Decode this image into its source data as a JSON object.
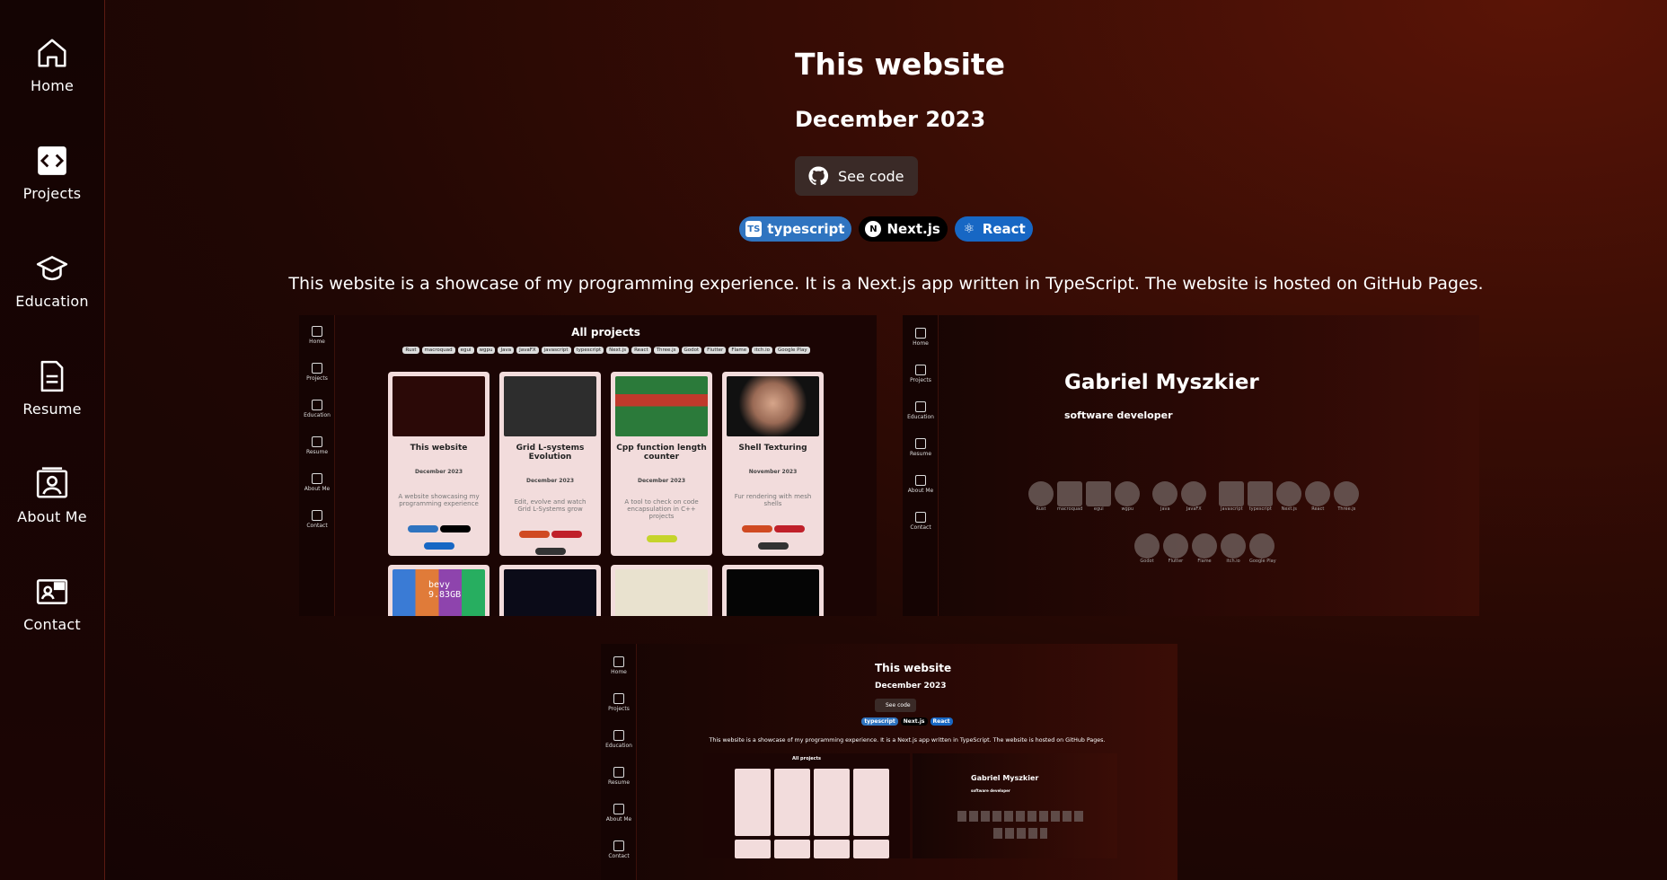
{
  "sidebar": {
    "items": [
      {
        "label": "Home",
        "icon": "home-icon"
      },
      {
        "label": "Projects",
        "icon": "code-icon"
      },
      {
        "label": "Education",
        "icon": "graduation-cap-icon"
      },
      {
        "label": "Resume",
        "icon": "document-icon"
      },
      {
        "label": "About Me",
        "icon": "user-card-icon"
      },
      {
        "label": "Contact",
        "icon": "contact-card-icon"
      }
    ]
  },
  "project": {
    "title": "This website",
    "date": "December 2023",
    "see_code_label": "See code",
    "tags": [
      {
        "label": "typescript",
        "icon": "TS"
      },
      {
        "label": "Next.js",
        "icon": "N"
      },
      {
        "label": "React",
        "icon": "⚛"
      }
    ],
    "description": "This website is a showcase of my programming experience. It is a Next.js app written in TypeScript. The website is hosted on GitHub Pages."
  },
  "screenshot_projects": {
    "heading": "All projects",
    "filter_tags": [
      "Rust",
      "macroquad",
      "egui",
      "wgpu",
      "Java",
      "JavaFX",
      "javascript",
      "typescript",
      "Next.js",
      "React",
      "Three.js",
      "Godot",
      "Flutter",
      "Flame",
      "itch.io",
      "Google Play"
    ],
    "nav": [
      "Home",
      "Projects",
      "Education",
      "Resume",
      "About Me",
      "Contact"
    ],
    "cards": [
      {
        "title": "This website",
        "date": "December 2023",
        "text": "A website showcasing my programming experience"
      },
      {
        "title": "Grid L-systems Evolution",
        "date": "December 2023",
        "text": "Edit, evolve and watch Grid L-Systems grow"
      },
      {
        "title": "Cpp function length counter",
        "date": "December 2023",
        "text": "A tool to check on code encapsulation in C++ projects"
      },
      {
        "title": "Shell Texturing",
        "date": "November 2023",
        "text": "Fur rendering with mesh shells"
      }
    ],
    "bevy_text": "bevy\n9.83GB"
  },
  "screenshot_home": {
    "name": "Gabriel Myszkier",
    "role": "software developer",
    "skills_row1": [
      "Rust",
      "macroquad",
      "egui",
      "wgpu",
      "Java",
      "JavaFX",
      "Javascript",
      "typescript",
      "Next.js",
      "React",
      "Three.js"
    ],
    "skills_row2": [
      "Godot",
      "Flutter",
      "Flame",
      "itch.io",
      "Google Play"
    ],
    "nav": [
      "Home",
      "Projects",
      "Education",
      "Resume",
      "About Me",
      "Contact"
    ]
  },
  "screenshot_self": {
    "title": "This website",
    "date": "December 2023",
    "see_code_label": "See code",
    "tags": [
      "typescript",
      "Next.js",
      "React"
    ],
    "description": "This website is a showcase of my programming experience. It is a Next.js app written in TypeScript. The website is hosted on GitHub Pages.",
    "inner_heading": "All projects",
    "inner_name": "Gabriel Myszkier",
    "inner_role": "software developer",
    "nav": [
      "Home",
      "Projects",
      "Education",
      "Resume",
      "About Me",
      "Contact"
    ]
  },
  "colors": {
    "accent_red": "#5b1a12",
    "button_bg": "#3a2a27",
    "ts_blue": "#2f74c0",
    "react_blue": "#1767c4"
  }
}
